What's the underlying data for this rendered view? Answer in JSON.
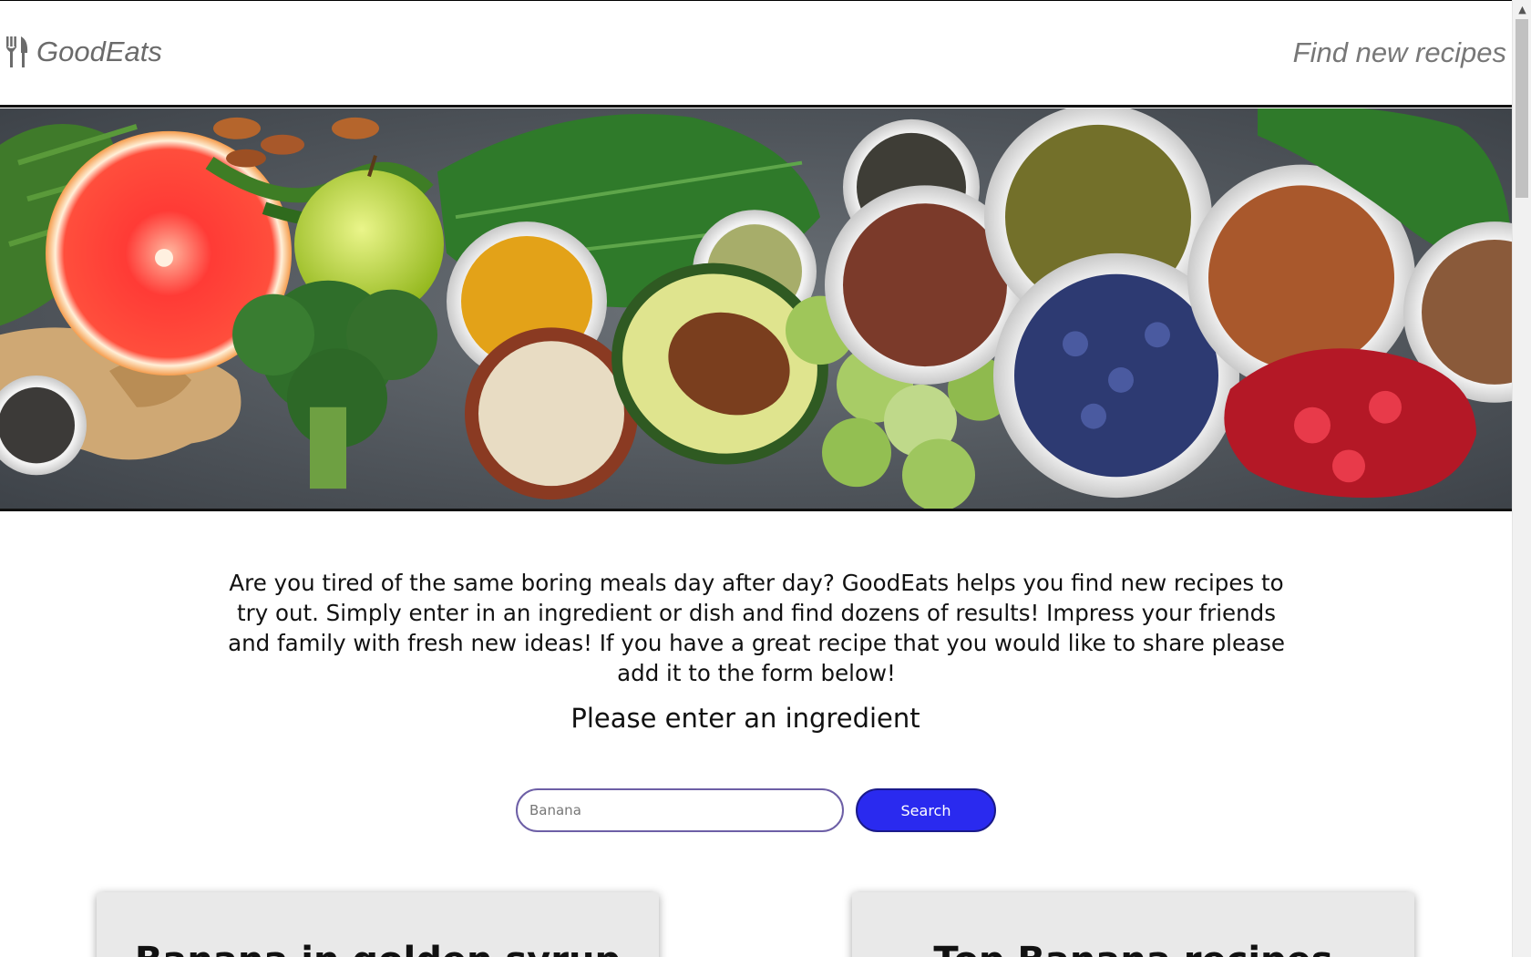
{
  "header": {
    "brand_icon": "fork-knife-icon",
    "brand_name": "GoodEats",
    "nav_link": "Find new recipes"
  },
  "hero": {
    "image": "vegetables-fruits-spices-bowls-photo"
  },
  "intro": {
    "text": "Are you tired of the same boring meals day after day? GoodEats helps you find new recipes to try out. Simply enter in an ingredient or dish and find dozens of results! Impress your friends and family with fresh new ideas! If you have a great recipe that you would like to share please add it to the form below!"
  },
  "search": {
    "prompt": "Please enter an ingredient",
    "placeholder": "Banana",
    "value": "",
    "button_label": "Search",
    "button_color": "#2a2aef"
  },
  "cards": [
    {
      "title": "Banana in golden syrup"
    },
    {
      "title": "Top Banana recipes"
    }
  ],
  "scrollbar": {
    "up_arrow_icon": "chevron-up-icon"
  }
}
